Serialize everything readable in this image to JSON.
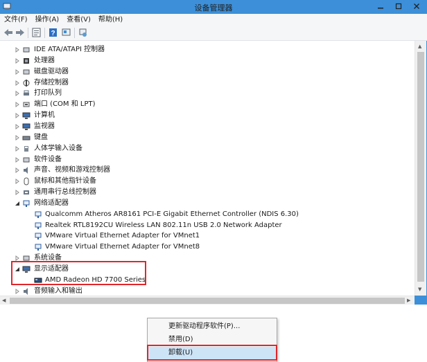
{
  "window": {
    "title": "设备管理器"
  },
  "menu": [
    "文件(F)",
    "操作(A)",
    "查看(V)",
    "帮助(H)"
  ],
  "tree": [
    {
      "label": "IDE ATA/ATAPI 控制器",
      "icon": "ide-controller-icon",
      "expanded": false
    },
    {
      "label": "处理器",
      "icon": "processor-icon",
      "expanded": false
    },
    {
      "label": "磁盘驱动器",
      "icon": "disk-drive-icon",
      "expanded": false
    },
    {
      "label": "存储控制器",
      "icon": "storage-controller-icon",
      "expanded": false
    },
    {
      "label": "打印队列",
      "icon": "printer-icon",
      "expanded": false
    },
    {
      "label": "端口 (COM 和 LPT)",
      "icon": "port-icon",
      "expanded": false
    },
    {
      "label": "计算机",
      "icon": "computer-icon",
      "expanded": false
    },
    {
      "label": "监视器",
      "icon": "monitor-icon",
      "expanded": false
    },
    {
      "label": "键盘",
      "icon": "keyboard-icon",
      "expanded": false
    },
    {
      "label": "人体学输入设备",
      "icon": "hid-icon",
      "expanded": false
    },
    {
      "label": "软件设备",
      "icon": "software-device-icon",
      "expanded": false
    },
    {
      "label": "声音、视频和游戏控制器",
      "icon": "sound-icon",
      "expanded": false
    },
    {
      "label": "鼠标和其他指针设备",
      "icon": "mouse-icon",
      "expanded": false
    },
    {
      "label": "通用串行总线控制器",
      "icon": "usb-icon",
      "expanded": false
    },
    {
      "label": "网络适配器",
      "icon": "network-adapter-icon",
      "expanded": true,
      "children": [
        "Qualcomm Atheros AR8161 PCI-E Gigabit Ethernet Controller (NDIS 6.30)",
        "Realtek RTL8192CU Wireless LAN 802.11n USB 2.0 Network Adapter",
        "VMware Virtual Ethernet Adapter for VMnet1",
        "VMware Virtual Ethernet Adapter for VMnet8"
      ]
    },
    {
      "label": "系统设备",
      "icon": "system-device-icon",
      "expanded": false
    },
    {
      "label": "显示适配器",
      "icon": "display-adapter-icon",
      "expanded": true,
      "children": [
        "AMD Radeon HD 7700 Series"
      ]
    },
    {
      "label": "音频输入和输出",
      "icon": "audio-io-icon",
      "expanded": false
    }
  ],
  "context_menu": {
    "items": [
      "更新驱动程序软件(P)...",
      "禁用(D)",
      "卸载(U)"
    ],
    "active_index": 2
  },
  "colors": {
    "titlebar": "#3c8fd8",
    "highlight": "#e0262b",
    "menu_hover": "#cde4f7"
  }
}
